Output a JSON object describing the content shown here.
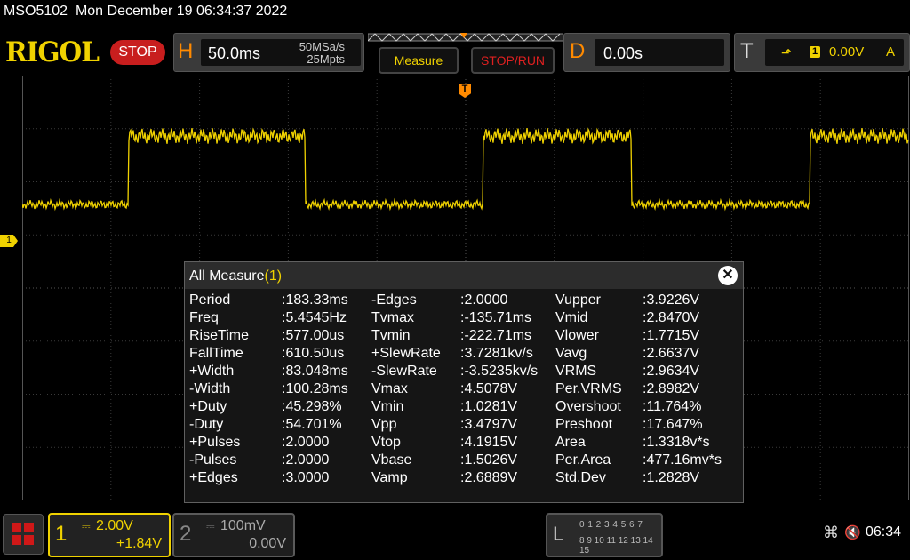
{
  "header": {
    "model": "MSO5102",
    "datetime": "Mon December 19 06:34:37 2022",
    "brand": "RIGOL",
    "run_state": "STOP"
  },
  "horizontal": {
    "letter": "H",
    "timebase": "50.0ms",
    "sample_rate": "50MSa/s",
    "memory_depth": "25Mpts"
  },
  "buttons": {
    "measure": "Measure",
    "stop_run": "STOP/RUN"
  },
  "delay": {
    "letter": "D",
    "value": "0.00s"
  },
  "trigger": {
    "letter": "T",
    "source": "1",
    "level": "0.00V",
    "mode": "A"
  },
  "markers": {
    "ch1": "1",
    "trigger": "T"
  },
  "measure_panel": {
    "title": "All Measure",
    "channel": "(1)",
    "columns": [
      [
        {
          "label": "Period",
          "value": ":183.33ms"
        },
        {
          "label": "Freq",
          "value": ":5.4545Hz"
        },
        {
          "label": "RiseTime",
          "value": ":577.00us"
        },
        {
          "label": "FallTime",
          "value": ":610.50us"
        },
        {
          "label": "+Width",
          "value": ":83.048ms"
        },
        {
          "label": "-Width",
          "value": ":100.28ms"
        },
        {
          "label": "+Duty",
          "value": ":45.298%"
        },
        {
          "label": "-Duty",
          "value": ":54.701%"
        },
        {
          "label": "+Pulses",
          "value": ":2.0000"
        },
        {
          "label": "-Pulses",
          "value": ":2.0000"
        },
        {
          "label": "+Edges",
          "value": ":3.0000"
        }
      ],
      [
        {
          "label": "-Edges",
          "value": ":2.0000"
        },
        {
          "label": "Tvmax",
          "value": ":-135.71ms"
        },
        {
          "label": "Tvmin",
          "value": ":-222.71ms"
        },
        {
          "label": "+SlewRate",
          "value": ":3.7281kv/s"
        },
        {
          "label": "-SlewRate",
          "value": ":-3.5235kv/s"
        },
        {
          "label": "Vmax",
          "value": ":4.5078V"
        },
        {
          "label": "Vmin",
          "value": ":1.0281V"
        },
        {
          "label": "Vpp",
          "value": ":3.4797V"
        },
        {
          "label": "Vtop",
          "value": ":4.1915V"
        },
        {
          "label": "Vbase",
          "value": ":1.5026V"
        },
        {
          "label": "Vamp",
          "value": ":2.6889V"
        }
      ],
      [
        {
          "label": "Vupper",
          "value": ":3.9226V"
        },
        {
          "label": "Vmid",
          "value": ":2.8470V"
        },
        {
          "label": "Vlower",
          "value": ":1.7715V"
        },
        {
          "label": "Vavg",
          "value": ":2.6637V"
        },
        {
          "label": "VRMS",
          "value": ":2.9634V"
        },
        {
          "label": "Per.VRMS",
          "value": ":2.8982V"
        },
        {
          "label": "Overshoot",
          "value": ":11.764%"
        },
        {
          "label": "Preshoot",
          "value": ":17.647%"
        },
        {
          "label": "Area",
          "value": ":1.3318v*s"
        },
        {
          "label": "Per.Area",
          "value": ":477.16mv*s"
        },
        {
          "label": "Std.Dev",
          "value": ":1.2828V"
        }
      ]
    ]
  },
  "channel1": {
    "number": "1",
    "scale": "2.00V",
    "offset": "+1.84V"
  },
  "channel2": {
    "number": "2",
    "scale": "100mV",
    "offset": "0.00V"
  },
  "logic": {
    "letter": "L",
    "row1": "0 1 2 3  4 5 6 7",
    "row2": "8 9 10 11 12 13 14 15"
  },
  "status": {
    "time": "06:34"
  },
  "colors": {
    "ch1": "#f0d200",
    "accent": "#ff8a00",
    "stop": "#c81e1e"
  }
}
